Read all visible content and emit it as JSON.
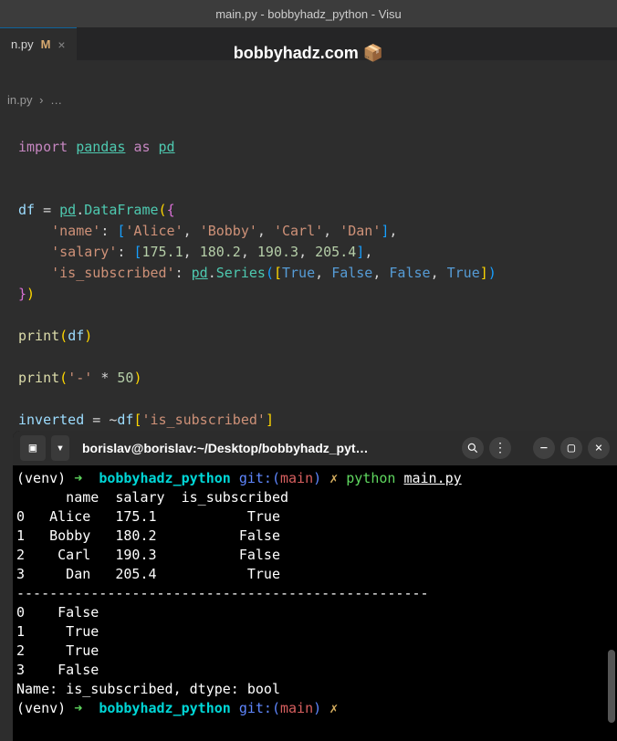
{
  "window": {
    "title": "main.py - bobbyhadz_python - Visu"
  },
  "tab": {
    "filename": "n.py",
    "modified_indicator": "M",
    "close": "×"
  },
  "header": {
    "text": "bobbyhadz.com 📦"
  },
  "breadcrumb": {
    "file": "in.py",
    "sep": "›",
    "rest": "…"
  },
  "code": {
    "import": "import",
    "pandas": "pandas",
    "as": "as",
    "pd": "pd",
    "df": "df",
    "equals": "=",
    "DataFrame": "DataFrame",
    "name_key": "'name'",
    "name_v1": "'Alice'",
    "name_v2": "'Bobby'",
    "name_v3": "'Carl'",
    "name_v4": "'Dan'",
    "salary_key": "'salary'",
    "salary_v1": "175.1",
    "salary_v2": "180.2",
    "salary_v3": "190.3",
    "salary_v4": "205.4",
    "sub_key": "'is_subscribed'",
    "Series": "Series",
    "true": "True",
    "false": "False",
    "print": "print",
    "dash": "'-'",
    "star": "*",
    "fifty": "50",
    "inverted": "inverted",
    "tilde": "~",
    "sub_str": "'is_subscribed'"
  },
  "terminal": {
    "title": "borislav@borislav:~/Desktop/bobbyhadz_pyt…",
    "prompt": {
      "venv": "(venv)",
      "arrow": "➜",
      "dir": "bobbyhadz_python",
      "git": "git:(",
      "branch": "main",
      "git_close": ")",
      "dirty": "✗",
      "cmd_python": "python",
      "cmd_file": "main.py"
    },
    "output": {
      "header": "      name  salary  is_subscribed",
      "row0": "0   Alice   175.1           True",
      "row1": "1   Bobby   180.2          False",
      "row2": "2    Carl   190.3          False",
      "row3": "3     Dan   205.4           True",
      "sep": "--------------------------------------------------",
      "inv0": "0    False",
      "inv1": "1     True",
      "inv2": "2     True",
      "inv3": "3    False",
      "meta": "Name: is_subscribed, dtype: bool"
    }
  }
}
